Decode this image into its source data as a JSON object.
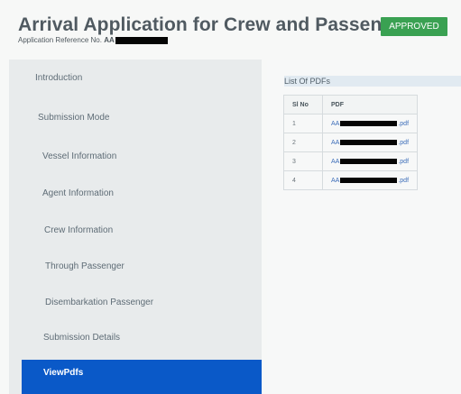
{
  "header": {
    "title": "Arrival Application for Crew and Passengers",
    "reference_label": "Application Reference No.",
    "reference_prefix": "AA",
    "status_badge": "APPROVED"
  },
  "sidebar": {
    "items": [
      {
        "label": "Introduction"
      },
      {
        "label": "Submission Mode"
      },
      {
        "label": "Vessel Information"
      },
      {
        "label": "Agent Information"
      },
      {
        "label": "Crew Information"
      },
      {
        "label": "Through Passenger"
      },
      {
        "label": "Disembarkation Passenger"
      },
      {
        "label": "Submission Details"
      },
      {
        "label": "ViewPdfs"
      }
    ]
  },
  "pdf_list": {
    "heading": "List Of PDFs",
    "columns": [
      "Sl No",
      "PDF"
    ],
    "rows": [
      {
        "sl": "1",
        "prefix": "AA",
        "suffix": ".pdf"
      },
      {
        "sl": "2",
        "prefix": "AA",
        "suffix": ".pdf"
      },
      {
        "sl": "3",
        "prefix": "AA",
        "suffix": ".pdf"
      },
      {
        "sl": "4",
        "prefix": "AA",
        "suffix": ".pdf"
      }
    ]
  },
  "colors": {
    "approved_badge": "#3aa152",
    "active_sidebar": "#0a59c8",
    "sidebar_bg": "#e8ebec",
    "link": "#3c6db9"
  }
}
